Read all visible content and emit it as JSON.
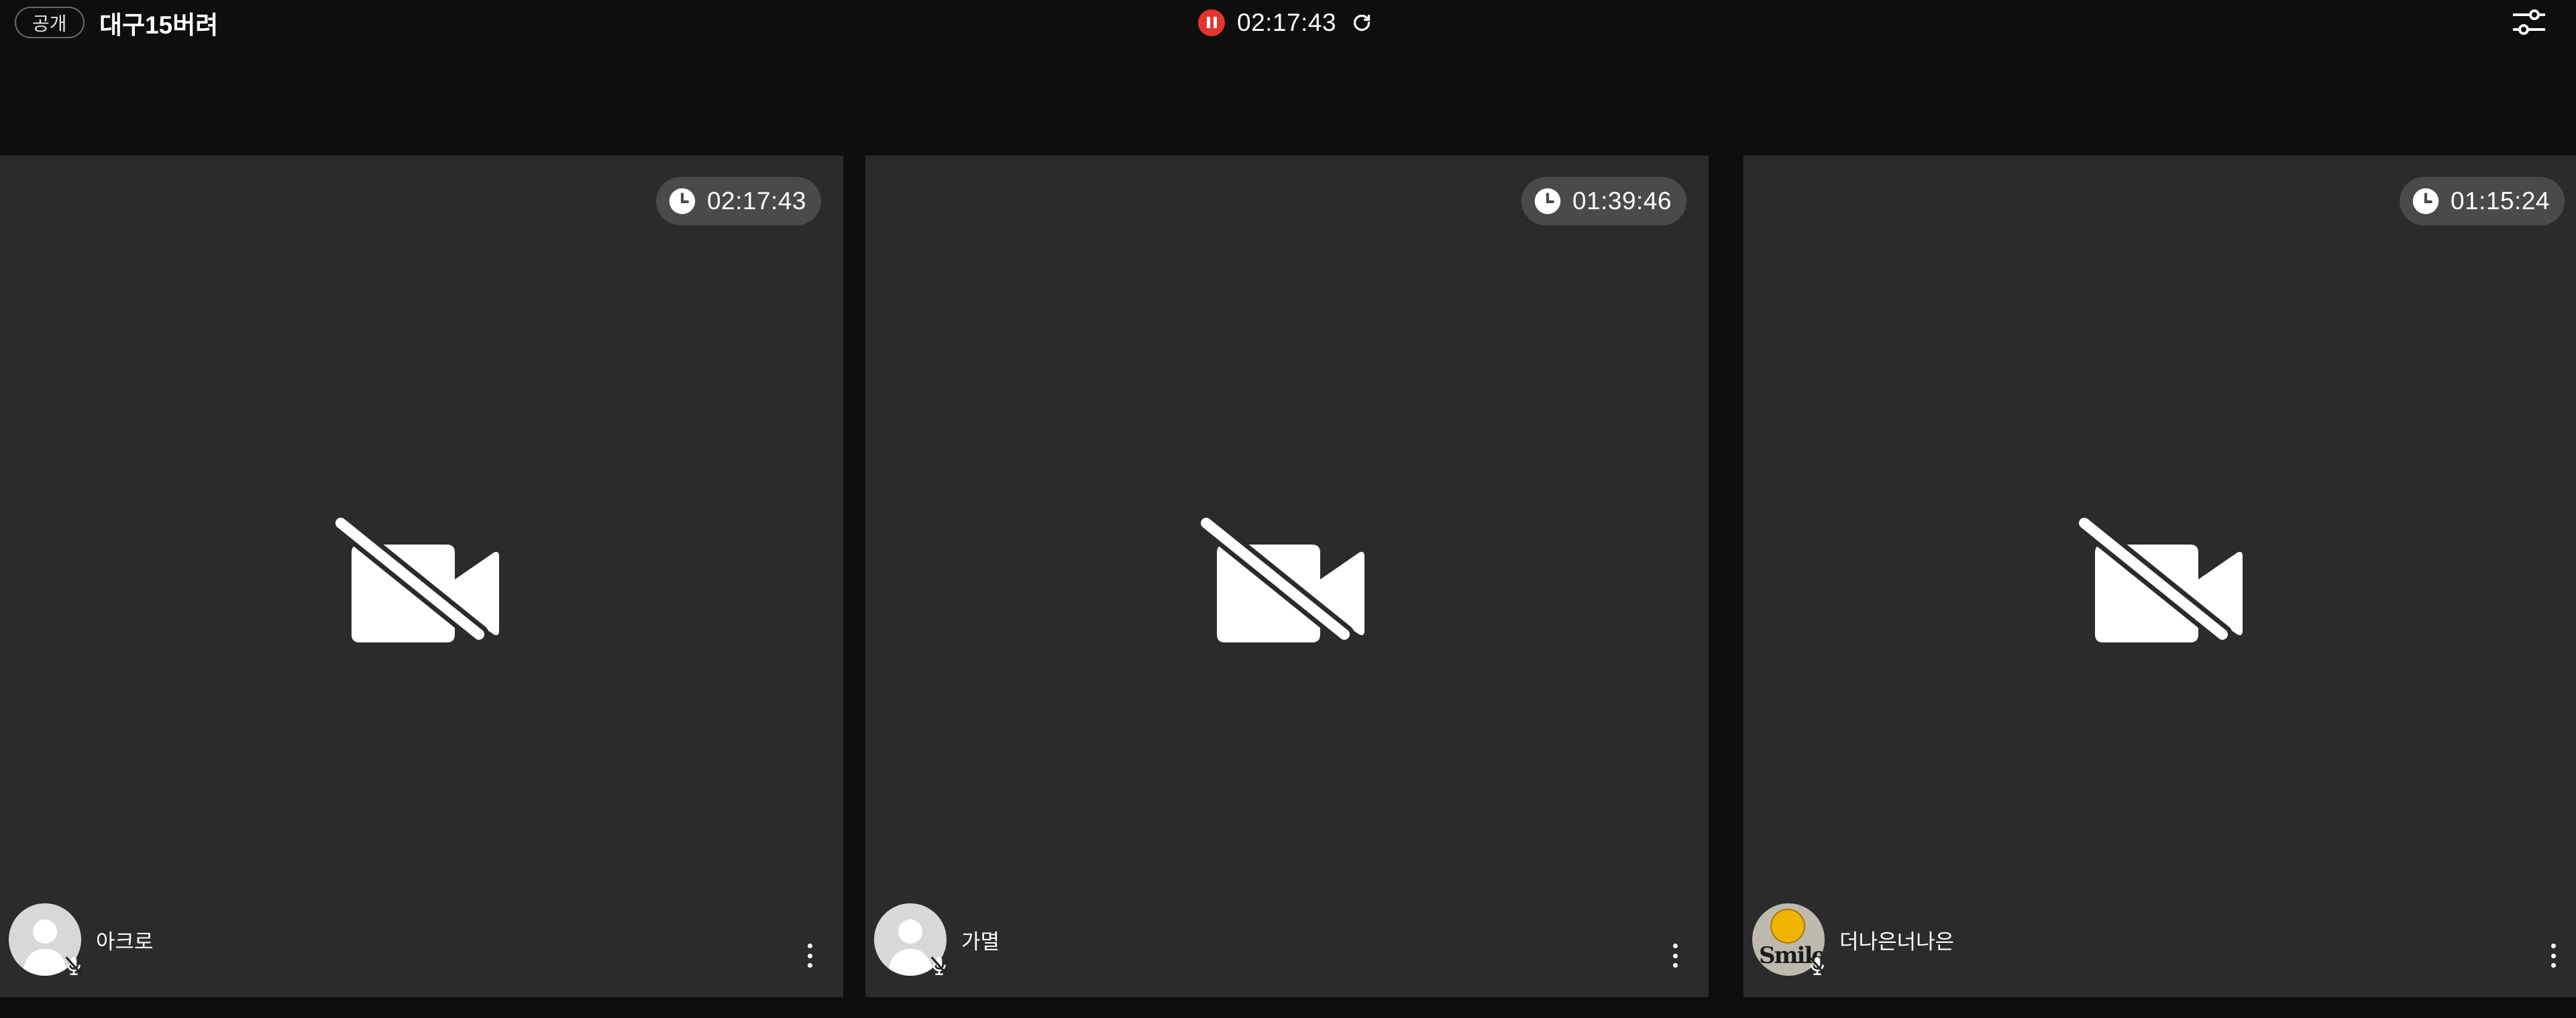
{
  "header": {
    "visibility_label": "공개",
    "room_title": "대구15버려",
    "session_time": "02:17:43",
    "status_color": "#e3342f",
    "icons": [
      "pause-icon",
      "refresh-icon",
      "settings-sliders-icon"
    ]
  },
  "tiles": [
    {
      "timer": "02:17:43",
      "name": "아크로",
      "avatar": "default-person-icon",
      "camera": "camera-off-icon",
      "mic": "mic-off-icon"
    },
    {
      "timer": "01:39:46",
      "name": "가멸",
      "avatar": "default-person-icon",
      "camera": "camera-off-icon",
      "mic": "mic-off-icon"
    },
    {
      "timer": "01:15:24",
      "name": "더나은너나은",
      "avatar": "smile-avatar",
      "avatar_text": "Smile",
      "camera": "camera-off-icon",
      "mic": "mic-off-icon"
    }
  ]
}
